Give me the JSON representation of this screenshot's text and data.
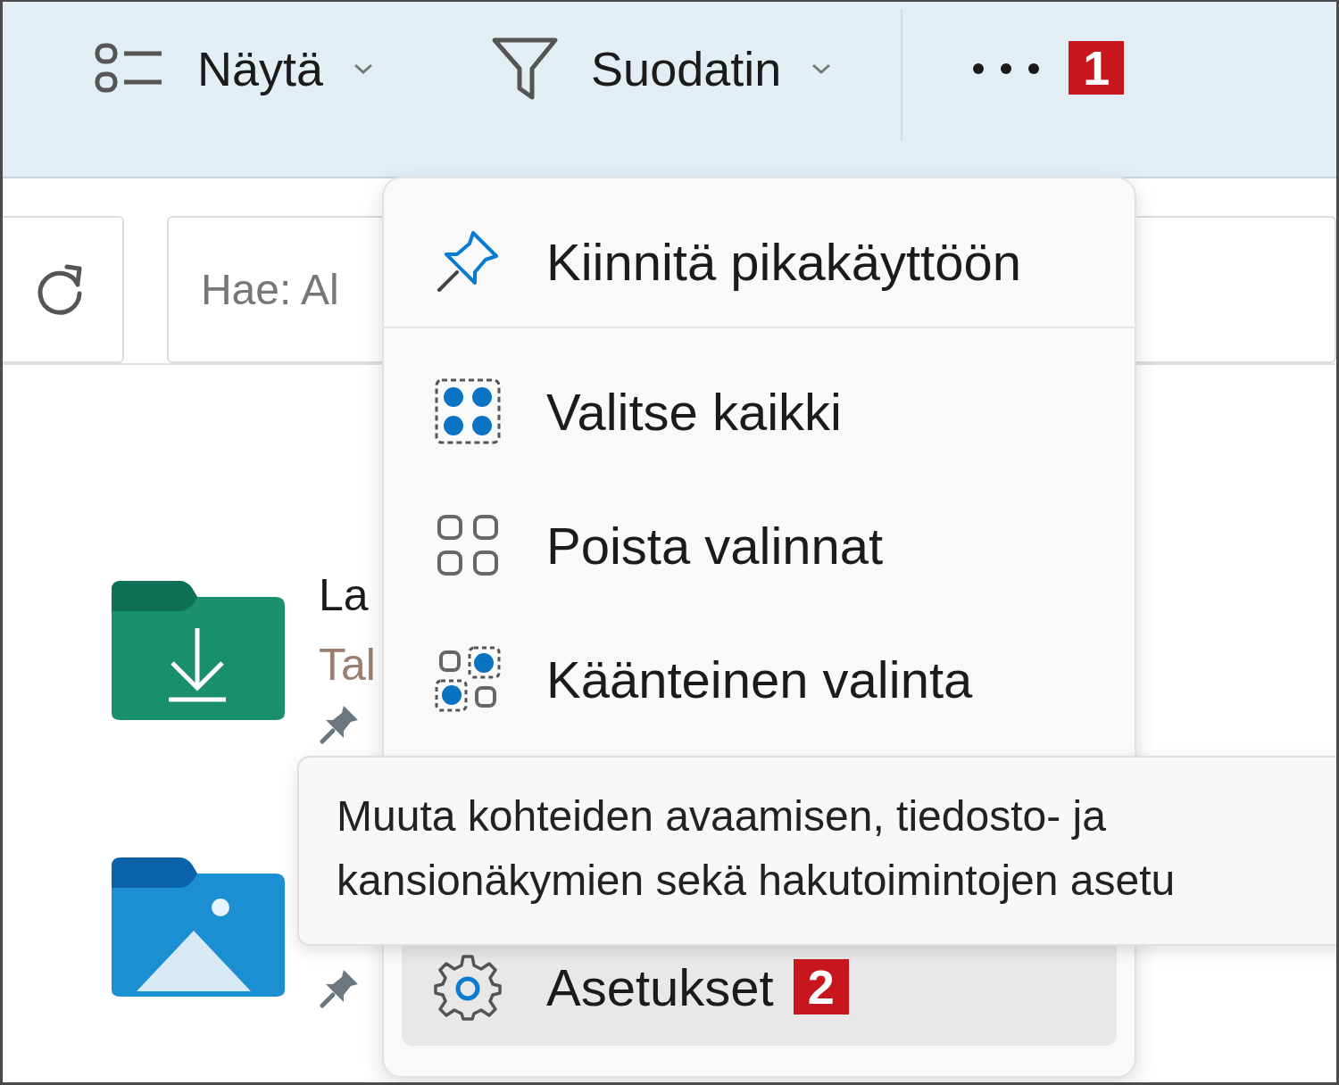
{
  "toolbar": {
    "items": [
      {
        "kind": "view",
        "label": "Näytä"
      },
      {
        "kind": "filter",
        "label": "Suodatin"
      }
    ],
    "more_badge": "1"
  },
  "search": {
    "placeholder": "Hae: Al"
  },
  "folders": [
    {
      "kind": "downloads",
      "name": "La",
      "subtitle": "Tal",
      "pinned": true
    },
    {
      "kind": "pictures",
      "pinned": true
    }
  ],
  "menu": {
    "items": [
      {
        "kind": "pin",
        "label": "Kiinnitä pikakäyttöön",
        "selected": false,
        "separator_after": true
      },
      {
        "kind": "select_all",
        "label": "Valitse kaikki",
        "selected": false,
        "separator_after": false
      },
      {
        "kind": "select_none",
        "label": "Poista valinnat",
        "selected": false,
        "separator_after": false
      },
      {
        "kind": "invert",
        "label": "Käänteinen valinta",
        "selected": false,
        "separator_after": false
      },
      {
        "kind": "settings",
        "label": "Asetukset",
        "selected": true,
        "separator_after": false,
        "badge": "2"
      }
    ]
  },
  "tooltip": {
    "lines": [
      "Muuta kohteiden avaamisen, tiedosto- ja",
      "kansionäkymien sekä hakutoimintojen asetu"
    ]
  }
}
